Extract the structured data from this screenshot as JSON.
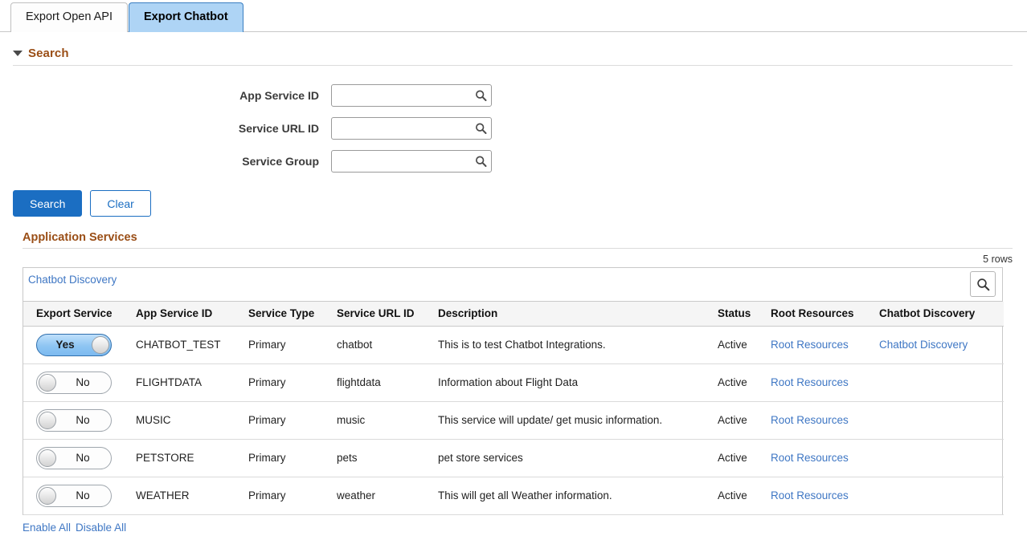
{
  "tabs": [
    {
      "label": "Export Open API",
      "active": false
    },
    {
      "label": "Export Chatbot",
      "active": true
    }
  ],
  "search_section": {
    "title": "Search",
    "caret": "caret-down-icon",
    "fields": [
      {
        "label": "App Service ID",
        "value": "",
        "placeholder": "",
        "lookup_icon": "search-icon"
      },
      {
        "label": "Service URL ID",
        "value": "",
        "placeholder": "",
        "lookup_icon": "search-icon"
      },
      {
        "label": "Service Group",
        "value": "",
        "placeholder": "",
        "lookup_icon": "search-icon"
      }
    ],
    "search_button": "Search",
    "clear_button": "Clear"
  },
  "app_services": {
    "title": "Application Services",
    "rows_count": "5 rows",
    "grid_tab_label": "Chatbot Discovery",
    "grid_search_icon": "search-icon",
    "columns": [
      "Export Service",
      "App Service ID",
      "Service Type",
      "Service URL ID",
      "Description",
      "Status",
      "Root Resources",
      "Chatbot Discovery"
    ],
    "rows": [
      {
        "export_service": "Yes",
        "export_on": true,
        "app_service_id": "CHATBOT_TEST",
        "service_type": "Primary",
        "service_url_id": "chatbot",
        "description": "This is to test Chatbot Integrations.",
        "status": "Active",
        "root_resources": "Root Resources",
        "chatbot_discovery": "Chatbot Discovery"
      },
      {
        "export_service": "No",
        "export_on": false,
        "app_service_id": "FLIGHTDATA",
        "service_type": "Primary",
        "service_url_id": "flightdata",
        "description": "Information about Flight Data",
        "status": "Active",
        "root_resources": "Root Resources",
        "chatbot_discovery": ""
      },
      {
        "export_service": "No",
        "export_on": false,
        "app_service_id": "MUSIC",
        "service_type": "Primary",
        "service_url_id": "music",
        "description": "This service will update/ get music information.",
        "status": "Active",
        "root_resources": "Root Resources",
        "chatbot_discovery": ""
      },
      {
        "export_service": "No",
        "export_on": false,
        "app_service_id": "PETSTORE",
        "service_type": "Primary",
        "service_url_id": "pets",
        "description": "pet store services",
        "status": "Active",
        "root_resources": "Root Resources",
        "chatbot_discovery": ""
      },
      {
        "export_service": "No",
        "export_on": false,
        "app_service_id": "WEATHER",
        "service_type": "Primary",
        "service_url_id": "weather",
        "description": "This will get all Weather information.",
        "status": "Active",
        "root_resources": "Root Resources",
        "chatbot_discovery": ""
      }
    ],
    "enable_all": "Enable All",
    "disable_all": "Disable All"
  },
  "colors": {
    "accent_blue": "#1b6ec2",
    "link_blue": "#3f77c4",
    "section_brown": "#9a4e16",
    "active_tab_bg": "#aed4f5",
    "toggle_on_bg": "#8ec5f2"
  }
}
